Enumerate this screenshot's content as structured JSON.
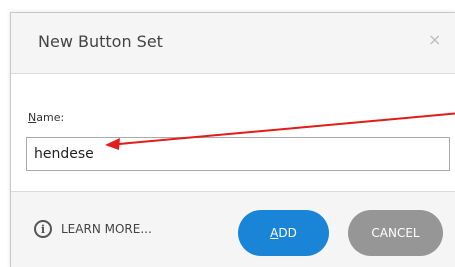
{
  "dialog": {
    "title": "New Button Set",
    "close_glyph": "×"
  },
  "form": {
    "name_label_accel": "N",
    "name_label_rest": "ame:",
    "name_value": "hendese"
  },
  "footer": {
    "learn_more_label": "LEARN MORE...",
    "info_glyph": "i",
    "add_accel": "A",
    "add_rest": "DD",
    "cancel_label": "CANCEL"
  },
  "colors": {
    "primary_button": "#1a85d6",
    "secondary_button": "#969696",
    "annotation_arrow": "#e21b1b"
  }
}
